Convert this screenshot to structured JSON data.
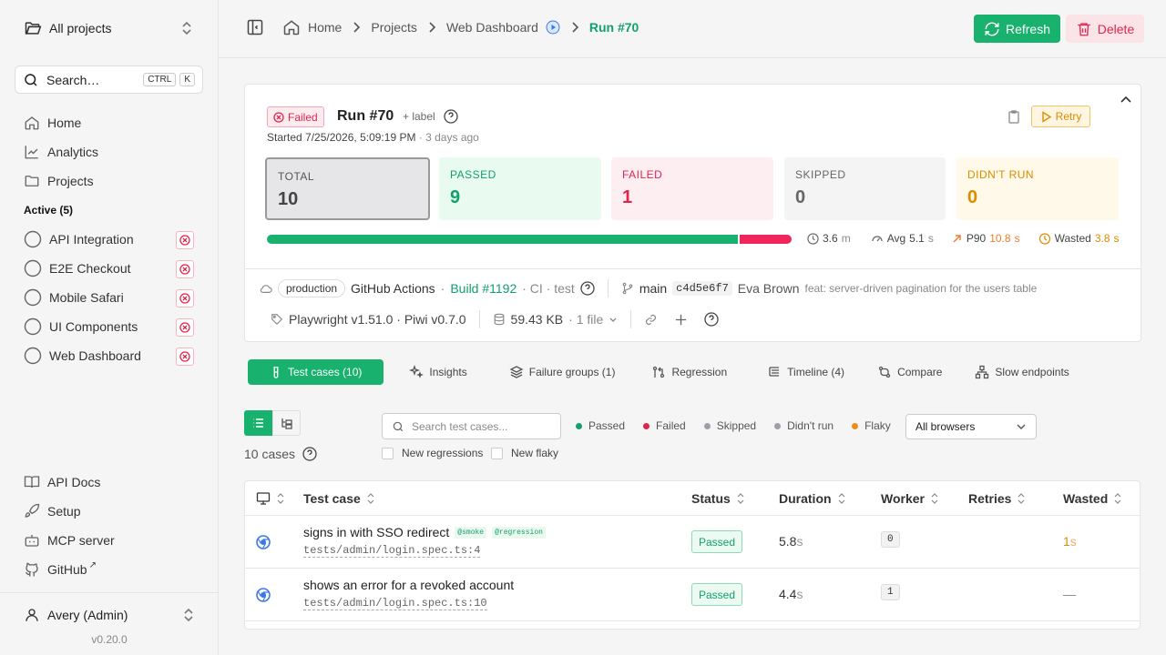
{
  "sidebar": {
    "project_selector": "All projects",
    "search": {
      "label": "Search…",
      "kbd1": "CTRL",
      "kbd2": "K"
    },
    "nav": [
      {
        "label": "Home"
      },
      {
        "label": "Analytics"
      },
      {
        "label": "Projects"
      }
    ],
    "active_section": "Active (5)",
    "active_projects": [
      {
        "label": "API Integration"
      },
      {
        "label": "E2E Checkout"
      },
      {
        "label": "Mobile Safari"
      },
      {
        "label": "UI Components"
      },
      {
        "label": "Web Dashboard"
      }
    ],
    "bottom_links": [
      {
        "label": "API Docs"
      },
      {
        "label": "Setup"
      },
      {
        "label": "MCP server"
      },
      {
        "label": "GitHub",
        "external": "↗"
      }
    ],
    "user": "Avery (Admin)",
    "version": "v0.20.0"
  },
  "header": {
    "breadcrumbs": [
      "Home",
      "Projects",
      "Web Dashboard"
    ],
    "current": "Run #70",
    "refresh": "Refresh",
    "delete": "Delete"
  },
  "run": {
    "status": "Failed",
    "title": "Run #70",
    "add_label": "+ label",
    "started": "Started 7/25/2026, 5:09:19 PM",
    "ago": "· 3 days ago",
    "retry": "Retry",
    "stats": [
      {
        "label": "TOTAL",
        "value": "10"
      },
      {
        "label": "PASSED",
        "value": "9"
      },
      {
        "label": "FAILED",
        "value": "1"
      },
      {
        "label": "SKIPPED",
        "value": "0"
      },
      {
        "label": "DIDN'T RUN",
        "value": "0"
      }
    ],
    "progress": {
      "passed": 9,
      "failed": 1,
      "total": 10
    },
    "metrics": {
      "duration": "3.6",
      "duration_unit": "m",
      "avg_label": "Avg",
      "avg": "5.1",
      "avg_unit": "s",
      "p90_label": "P90",
      "p90": "10.8",
      "p90_unit": "s",
      "wasted_label": "Wasted",
      "wasted": "3.8",
      "wasted_unit": "s"
    },
    "ci": {
      "env": "production",
      "provider": "GitHub Actions",
      "build": "Build #1192",
      "workflow": "· CI · test",
      "branch": "main",
      "commit": "c4d5e6f7",
      "author": "Eva Brown",
      "message": "feat: server-driven pagination for the users table",
      "tooling": "Playwright v1.51.0 · Piwi v0.7.0",
      "size": "59.43 KB",
      "files": "· 1 file"
    }
  },
  "tabs": [
    {
      "label": "Test cases (10)",
      "active": true
    },
    {
      "label": "Insights"
    },
    {
      "label": "Failure groups (1)"
    },
    {
      "label": "Regression"
    },
    {
      "label": "Timeline (4)"
    },
    {
      "label": "Compare"
    },
    {
      "label": "Slow endpoints"
    }
  ],
  "filters": {
    "cases_count": "10 cases",
    "search_placeholder": "Search test cases...",
    "legend": [
      {
        "label": "Passed",
        "color": "#13a06a"
      },
      {
        "label": "Failed",
        "color": "#e0254d"
      },
      {
        "label": "Skipped",
        "color": "#9aa0a6"
      },
      {
        "label": "Didn't run",
        "color": "#9aa0a6"
      },
      {
        "label": "Flaky",
        "color": "#f08a1c"
      }
    ],
    "browsers": "All browsers",
    "new_regressions": "New regressions",
    "new_flaky": "New flaky"
  },
  "table": {
    "headers": [
      "Test case",
      "Status",
      "Duration",
      "Worker",
      "Retries",
      "Wasted"
    ],
    "rows": [
      {
        "name": "signs in with SSO redirect",
        "tags": [
          "@smoke",
          "@regression"
        ],
        "path": "tests/admin/login.spec.ts:4",
        "status": "Passed",
        "duration": "5.8",
        "duration_unit": "s",
        "worker": "0",
        "wasted": "1",
        "wasted_unit": "s"
      },
      {
        "name": "shows an error for a revoked account",
        "tags": [],
        "path": "tests/admin/login.spec.ts:10",
        "status": "Passed",
        "duration": "4.4",
        "duration_unit": "s",
        "worker": "1",
        "wasted": "—",
        "wasted_unit": ""
      }
    ]
  },
  "colors": {
    "accent": "#18b16e",
    "failed": "#e0254d",
    "warning": "#e08a00"
  }
}
